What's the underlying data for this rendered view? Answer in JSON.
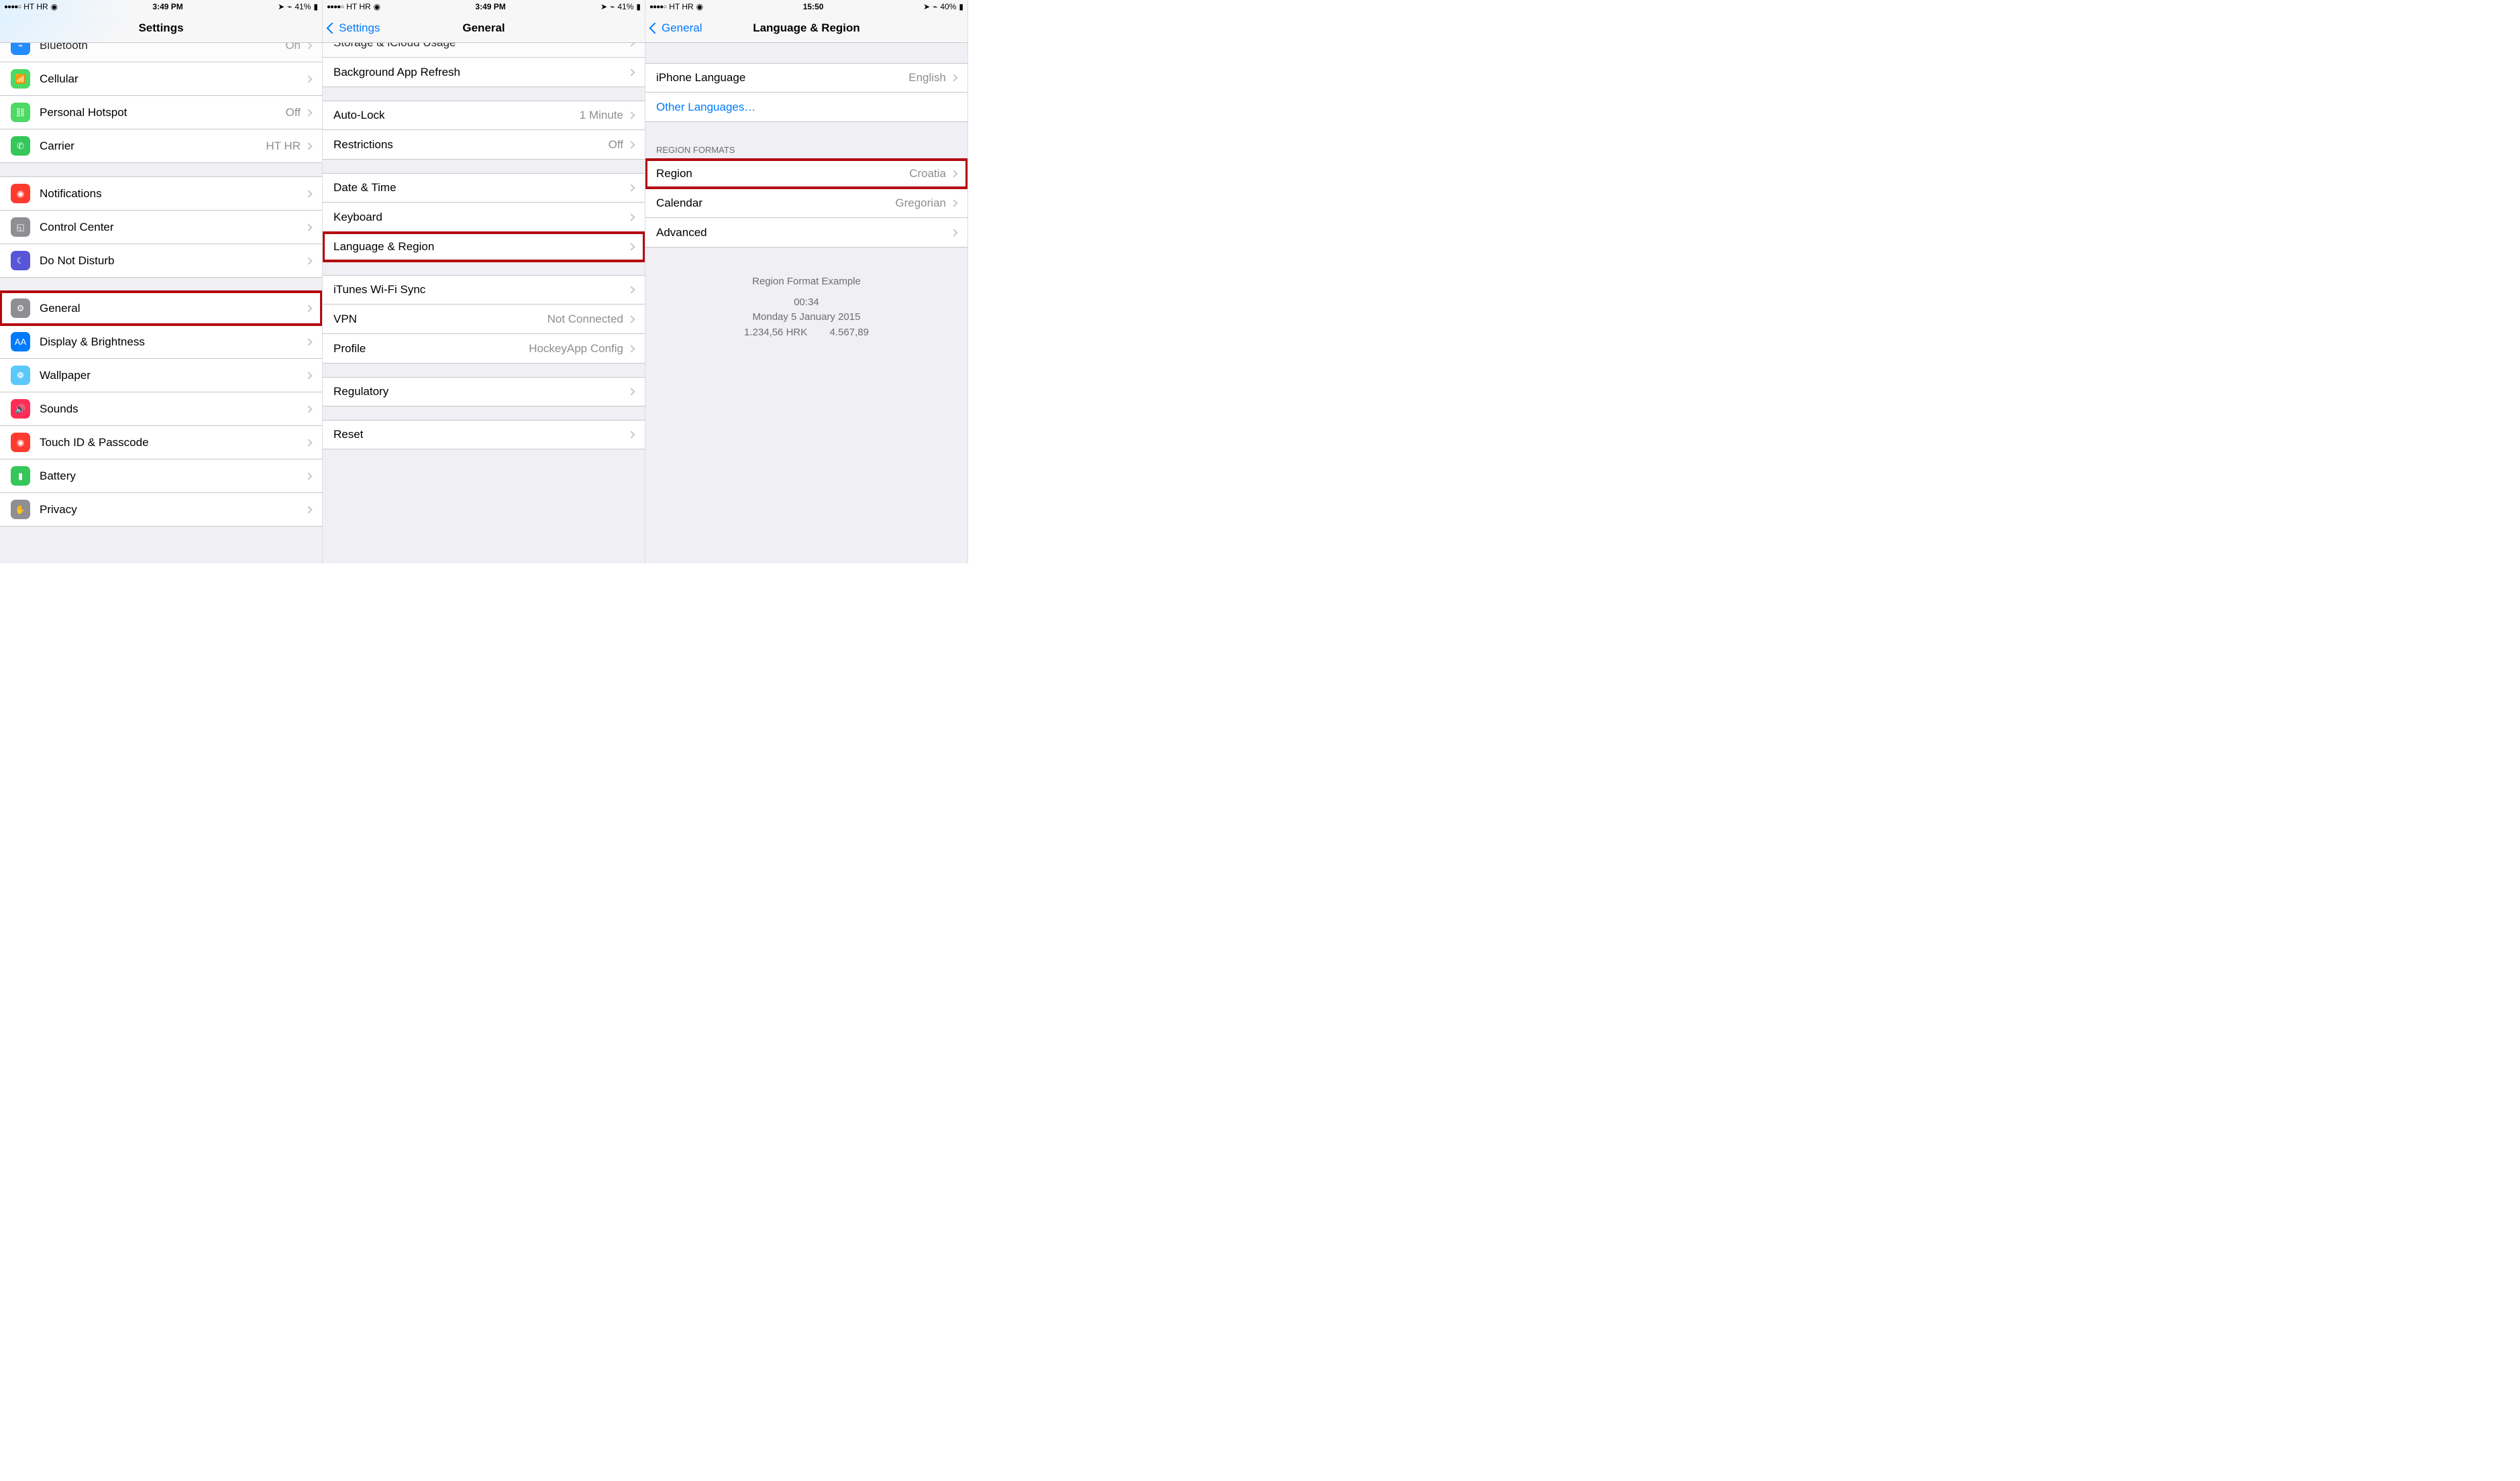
{
  "screens": [
    {
      "status": {
        "carrier": "HT HR",
        "time": "3:49 PM",
        "battery": "41%"
      },
      "title": "Settings",
      "back": null,
      "groups": [
        {
          "header": null,
          "partialTop": true,
          "items": [
            {
              "icon": "bluetooth-icon",
              "iconClass": "ic-blue",
              "glyph": "⌁",
              "label": "Bluetooth",
              "value": "On",
              "chevron": true,
              "highlight": false,
              "cutTop": true
            },
            {
              "icon": "cellular-icon",
              "iconClass": "ic-green",
              "glyph": "📶",
              "label": "Cellular",
              "value": "",
              "chevron": true,
              "highlight": false
            },
            {
              "icon": "hotspot-icon",
              "iconClass": "ic-green",
              "glyph": "⛓",
              "label": "Personal Hotspot",
              "value": "Off",
              "chevron": true,
              "highlight": false
            },
            {
              "icon": "carrier-icon",
              "iconClass": "ic-green2",
              "glyph": "✆",
              "label": "Carrier",
              "value": "HT HR",
              "chevron": true,
              "highlight": false
            }
          ]
        },
        {
          "header": null,
          "items": [
            {
              "icon": "notifications-icon",
              "iconClass": "ic-red",
              "glyph": "◉",
              "label": "Notifications",
              "value": "",
              "chevron": true,
              "highlight": false
            },
            {
              "icon": "control-center-icon",
              "iconClass": "ic-gray",
              "glyph": "◱",
              "label": "Control Center",
              "value": "",
              "chevron": true,
              "highlight": false
            },
            {
              "icon": "dnd-icon",
              "iconClass": "ic-purple",
              "glyph": "☾",
              "label": "Do Not Disturb",
              "value": "",
              "chevron": true,
              "highlight": false
            }
          ]
        },
        {
          "header": null,
          "items": [
            {
              "icon": "general-icon",
              "iconClass": "ic-gray",
              "glyph": "⚙",
              "label": "General",
              "value": "",
              "chevron": true,
              "highlight": true
            },
            {
              "icon": "display-icon",
              "iconClass": "ic-blue2",
              "glyph": "AA",
              "label": "Display & Brightness",
              "value": "",
              "chevron": true,
              "highlight": false
            },
            {
              "icon": "wallpaper-icon",
              "iconClass": "ic-teal",
              "glyph": "❁",
              "label": "Wallpaper",
              "value": "",
              "chevron": true,
              "highlight": false
            },
            {
              "icon": "sounds-icon",
              "iconClass": "ic-red2",
              "glyph": "🔊",
              "label": "Sounds",
              "value": "",
              "chevron": true,
              "highlight": false
            },
            {
              "icon": "touchid-icon",
              "iconClass": "ic-red",
              "glyph": "◉",
              "label": "Touch ID & Passcode",
              "value": "",
              "chevron": true,
              "highlight": false
            },
            {
              "icon": "battery-icon",
              "iconClass": "ic-green2",
              "glyph": "▮",
              "label": "Battery",
              "value": "",
              "chevron": true,
              "highlight": false
            },
            {
              "icon": "privacy-icon",
              "iconClass": "ic-gray",
              "glyph": "✋",
              "label": "Privacy",
              "value": "",
              "chevron": true,
              "highlight": false
            }
          ]
        }
      ]
    },
    {
      "status": {
        "carrier": "HT HR",
        "time": "3:49 PM",
        "battery": "41%"
      },
      "title": "General",
      "back": "Settings",
      "groups": [
        {
          "header": null,
          "partialTop": true,
          "items": [
            {
              "icon": null,
              "label": "Storage & iCloud Usage",
              "value": "",
              "chevron": true,
              "highlight": false,
              "cutTop": true
            },
            {
              "icon": null,
              "label": "Background App Refresh",
              "value": "",
              "chevron": true,
              "highlight": false
            }
          ]
        },
        {
          "header": null,
          "items": [
            {
              "icon": null,
              "label": "Auto-Lock",
              "value": "1 Minute",
              "chevron": true,
              "highlight": false
            },
            {
              "icon": null,
              "label": "Restrictions",
              "value": "Off",
              "chevron": true,
              "highlight": false
            }
          ]
        },
        {
          "header": null,
          "items": [
            {
              "icon": null,
              "label": "Date & Time",
              "value": "",
              "chevron": true,
              "highlight": false
            },
            {
              "icon": null,
              "label": "Keyboard",
              "value": "",
              "chevron": true,
              "highlight": false
            },
            {
              "icon": null,
              "label": "Language & Region",
              "value": "",
              "chevron": true,
              "highlight": true
            }
          ]
        },
        {
          "header": null,
          "items": [
            {
              "icon": null,
              "label": "iTunes Wi-Fi Sync",
              "value": "",
              "chevron": true,
              "highlight": false
            },
            {
              "icon": null,
              "label": "VPN",
              "value": "Not Connected",
              "chevron": true,
              "highlight": false
            },
            {
              "icon": null,
              "label": "Profile",
              "value": "HockeyApp Config",
              "chevron": true,
              "highlight": false
            }
          ]
        },
        {
          "header": null,
          "items": [
            {
              "icon": null,
              "label": "Regulatory",
              "value": "",
              "chevron": true,
              "highlight": false
            }
          ]
        },
        {
          "header": null,
          "partialBottom": true,
          "items": [
            {
              "icon": null,
              "label": "Reset",
              "value": "",
              "chevron": true,
              "highlight": false,
              "cutBottom": true
            }
          ]
        }
      ]
    },
    {
      "status": {
        "carrier": "HT HR",
        "time": "15:50",
        "battery": "40%"
      },
      "title": "Language & Region",
      "back": "General",
      "groups": [
        {
          "header": null,
          "items": [
            {
              "icon": null,
              "label": "iPhone Language",
              "value": "English",
              "chevron": true,
              "highlight": false
            },
            {
              "icon": null,
              "label": "Other Languages…",
              "value": "",
              "chevron": false,
              "highlight": false,
              "link": true
            }
          ]
        },
        {
          "header": "REGION FORMATS",
          "items": [
            {
              "icon": null,
              "label": "Region",
              "value": "Croatia",
              "chevron": true,
              "highlight": true
            },
            {
              "icon": null,
              "label": "Calendar",
              "value": "Gregorian",
              "chevron": true,
              "highlight": false
            },
            {
              "icon": null,
              "label": "Advanced",
              "value": "",
              "chevron": true,
              "highlight": false
            }
          ]
        }
      ],
      "example": {
        "title": "Region Format Example",
        "line1": "00:34",
        "line2": "Monday 5 January 2015",
        "line3": "1.234,56 HRK        4.567,89"
      }
    }
  ]
}
